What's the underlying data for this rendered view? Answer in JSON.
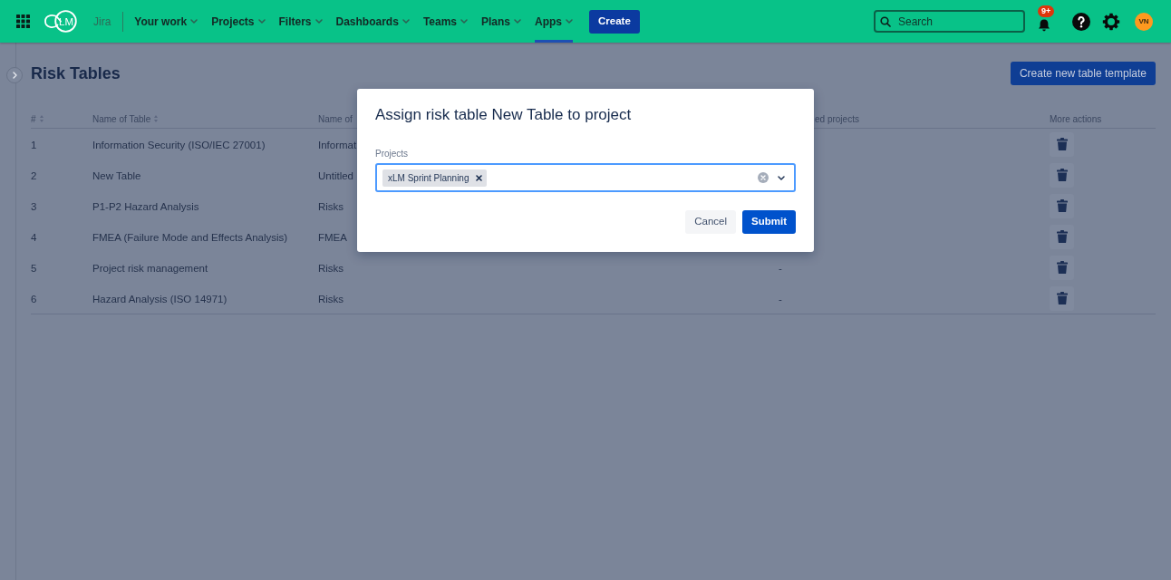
{
  "top_nav": {
    "logo": "LM",
    "product": "Jira",
    "items": [
      {
        "label": "Your work",
        "selected": false
      },
      {
        "label": "Projects",
        "selected": false
      },
      {
        "label": "Filters",
        "selected": false
      },
      {
        "label": "Dashboards",
        "selected": false
      },
      {
        "label": "Teams",
        "selected": false
      },
      {
        "label": "Plans",
        "selected": false
      },
      {
        "label": "Apps",
        "selected": true
      }
    ],
    "create_button": "Create",
    "search": {
      "placeholder": "Search"
    },
    "notification_badge": "9+",
    "avatar": "VN"
  },
  "page": {
    "title": "Risk Tables",
    "create_button": "Create new table template"
  },
  "table": {
    "columns": [
      {
        "label": "#",
        "sortable": true
      },
      {
        "label": "Name of Table",
        "sortable": true
      },
      {
        "label": "Name of",
        "sortable": false
      },
      {
        "label": "ed projects",
        "sortable": false
      },
      {
        "label": "More actions",
        "sortable": false
      }
    ],
    "rows": [
      {
        "number": "1",
        "name": "Information Security (ISO/IEC 27001)",
        "column_3": "Informat"
      },
      {
        "number": "2",
        "name": "New Table",
        "column_3": "Untitled"
      },
      {
        "number": "3",
        "name": "P1-P2 Hazard Analysis",
        "column_3": "Risks"
      },
      {
        "number": "4",
        "name": "FMEA (Failure Mode and Effects Analysis)",
        "column_3": "FMEA"
      },
      {
        "number": "5",
        "name": "Project risk management",
        "column_3": "Risks",
        "column_4": "-"
      },
      {
        "number": "6",
        "name": "Hazard Analysis (ISO 14971)",
        "column_3": "Risks",
        "column_4": "-"
      }
    ]
  },
  "dialog": {
    "title": "Assign risk table New Table to project",
    "field": {
      "label": "Projects",
      "focused": true,
      "values": [
        "xLM Sprint Planning"
      ]
    },
    "buttons": [
      {
        "label": "Cancel",
        "kind": "secondary"
      },
      {
        "label": "Submit",
        "kind": "primary"
      }
    ]
  }
}
